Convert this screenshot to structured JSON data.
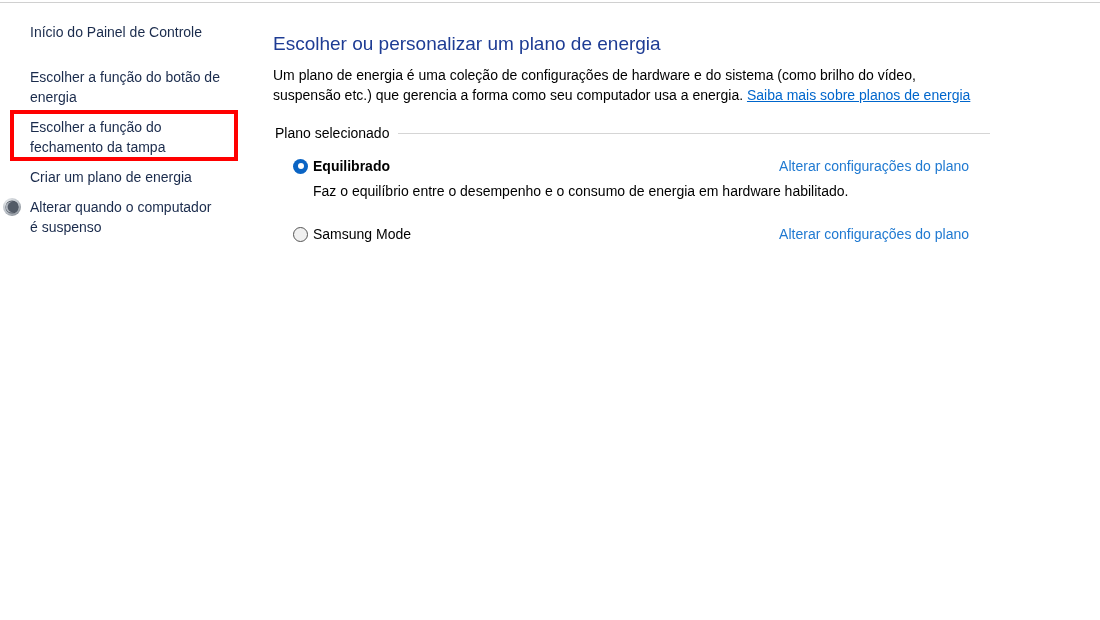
{
  "sidebar": {
    "items": [
      {
        "label": "Início do Painel de Controle",
        "kind": "home",
        "highlighted": false
      },
      {
        "label": "Escolher a função do botão de energia",
        "kind": "link",
        "highlighted": false
      },
      {
        "label": "Escolher a função do fechamento da tampa",
        "kind": "link",
        "highlighted": true
      },
      {
        "label": "Criar um plano de energia",
        "kind": "link",
        "highlighted": false
      },
      {
        "label": "Alterar quando o computador é suspenso",
        "kind": "icon-link",
        "highlighted": false
      }
    ]
  },
  "main": {
    "title": "Escolher ou personalizar um plano de energia",
    "description": "Um plano de energia é uma coleção de configurações de hardware e do sistema (como brilho do vídeo, suspensão etc.) que gerencia a forma como seu computador usa a energia.",
    "learn_more_link": "Saiba mais sobre planos de energia",
    "plans_group": {
      "label": "Plano selecionado",
      "plans": [
        {
          "name": "Equilibrado",
          "selected": true,
          "description": "Faz o equilíbrio entre o desempenho e o consumo de energia em hardware habilitado.",
          "settings_link": "Alterar configurações do plano"
        },
        {
          "name": "Samsung Mode",
          "selected": false,
          "settings_link": "Alterar configurações do plano"
        }
      ]
    }
  }
}
